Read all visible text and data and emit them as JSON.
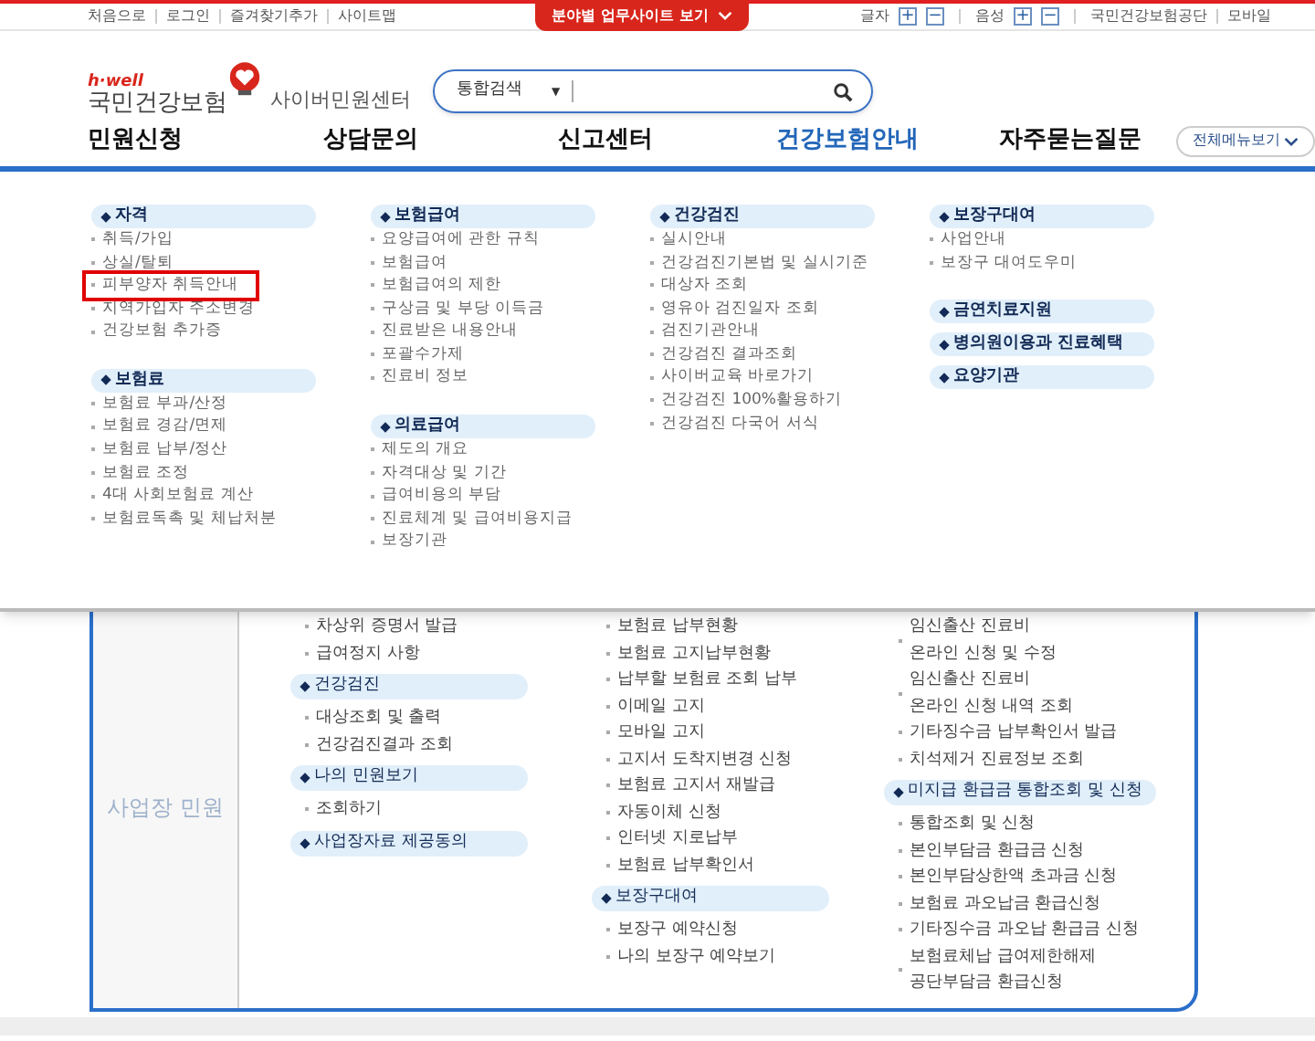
{
  "top_bar": {
    "links": [
      "처음으로",
      "로그인",
      "즐겨찾기추가",
      "사이트맵"
    ],
    "center_tab": "분야별 업무사이트 보기",
    "controls": [
      {
        "label": "글자",
        "plus": "+",
        "minus": "−"
      },
      {
        "label": "음성",
        "plus": "+",
        "minus": "−"
      }
    ],
    "right_links": [
      "국민건강보험공단",
      "모바일"
    ]
  },
  "header": {
    "brand_small": "h·well",
    "brand": "국민건강보험",
    "subtitle": "사이버민원센터",
    "search": {
      "scope": "통합검색",
      "caret": "▼"
    }
  },
  "nav": {
    "items": [
      {
        "label": "민원신청",
        "selected": false
      },
      {
        "label": "상담문의",
        "selected": false
      },
      {
        "label": "신고센터",
        "selected": false
      },
      {
        "label": "건강보험안내",
        "selected": true
      },
      {
        "label": "자주묻는질문",
        "selected": false
      }
    ],
    "all_menu": "전체메뉴보기"
  },
  "mega_menu": {
    "columns": [
      [
        {
          "title": "자격",
          "items": [
            {
              "label": "취득/가입",
              "highlighted": false
            },
            {
              "label": "상실/탈퇴",
              "highlighted": false
            },
            {
              "label": "피부양자 취득안내",
              "highlighted": true
            },
            {
              "label": "지역가입자 주소변경",
              "highlighted": false
            },
            {
              "label": "건강보험 추가증",
              "highlighted": false
            }
          ]
        },
        {
          "title": "보험료",
          "items": [
            {
              "label": "보험료 부과/산정",
              "highlighted": false
            },
            {
              "label": "보험료 경감/면제",
              "highlighted": false
            },
            {
              "label": "보험료 납부/정산",
              "highlighted": false
            },
            {
              "label": "보험료 조정",
              "highlighted": false
            },
            {
              "label": "4대 사회보험료 계산",
              "highlighted": false
            },
            {
              "label": "보험료독촉 및 체납처분",
              "highlighted": false
            }
          ]
        }
      ],
      [
        {
          "title": "보험급여",
          "items": [
            {
              "label": "요양급여에 관한 규칙",
              "highlighted": false
            },
            {
              "label": "보험급여",
              "highlighted": false
            },
            {
              "label": "보험급여의 제한",
              "highlighted": false
            },
            {
              "label": "구상금 및 부당 이득금",
              "highlighted": false
            },
            {
              "label": "진료받은 내용안내",
              "highlighted": false
            },
            {
              "label": "포괄수가제",
              "highlighted": false
            },
            {
              "label": "진료비 정보",
              "highlighted": false
            }
          ]
        },
        {
          "title": "의료급여",
          "items": [
            {
              "label": "제도의 개요",
              "highlighted": false
            },
            {
              "label": "자격대상 및 기간",
              "highlighted": false
            },
            {
              "label": "급여비용의 부담",
              "highlighted": false
            },
            {
              "label": "진료체계 및 급여비용지급",
              "highlighted": false
            },
            {
              "label": "보장기관",
              "highlighted": false
            }
          ]
        }
      ],
      [
        {
          "title": "건강검진",
          "items": [
            {
              "label": "실시안내",
              "highlighted": false
            },
            {
              "label": "건강검진기본법 및 실시기준",
              "highlighted": false
            },
            {
              "label": "대상자 조회",
              "highlighted": false
            },
            {
              "label": "영유아 검진일자 조회",
              "highlighted": false
            },
            {
              "label": "검진기관안내",
              "highlighted": false
            },
            {
              "label": "건강검진 결과조회",
              "highlighted": false
            },
            {
              "label": "사이버교육 바로가기",
              "highlighted": false
            },
            {
              "label": "건강검진 100%활용하기",
              "highlighted": false
            },
            {
              "label": "건강검진 다국어 서식",
              "highlighted": false
            }
          ]
        }
      ],
      [
        {
          "title": "보장구대여",
          "items": [
            {
              "label": "사업안내",
              "highlighted": false
            },
            {
              "label": "보장구 대여도우미",
              "highlighted": false
            }
          ]
        },
        {
          "title": "금연치료지원"
        },
        {
          "title": "병의원이용과 진료혜택"
        },
        {
          "title": "요양기관"
        }
      ]
    ]
  },
  "workplace": {
    "side_label": "사업장 민원",
    "columns": [
      [
        {
          "items": [
            "차상위 증명서 발급",
            "급여정지 사항"
          ]
        },
        {
          "title": "건강검진",
          "items": [
            "대상조회 및 출력",
            "건강검진결과 조회"
          ]
        },
        {
          "title": "나의 민원보기",
          "items": [
            "조회하기"
          ]
        },
        {
          "title": "사업장자료 제공동의"
        }
      ],
      [
        {
          "items": [
            "보험료 납부현황",
            "보험료 고지납부현황",
            "납부할 보험료 조회 납부",
            "이메일 고지",
            "모바일 고지",
            "고지서 도착지변경 신청",
            "보험료 고지서 재발급",
            "자동이체 신청",
            "인터넷 지로납부",
            "보험료 납부확인서"
          ]
        },
        {
          "title": "보장구대여",
          "items": [
            "보장구 예약신청",
            "나의 보장구 예약보기"
          ]
        }
      ],
      [
        {
          "items": [
            "임신출산 진료비\n온라인 신청 및 수정",
            "임신출산 진료비\n온라인 신청 내역 조회",
            "기타징수금 납부확인서 발급",
            "치석제거 진료정보 조회"
          ]
        },
        {
          "title": "미지급 환급금 통합조회 및 신청",
          "items": [
            "통합조회 및 신청",
            "본인부담금 환급금 신청",
            "본인부담상한액 초과금 신청",
            "보험료 과오납금 환급신청",
            "기타징수금 과오납 환급금 신청",
            "보험료체납 급여제한해제\n공단부담금 환급신청"
          ]
        }
      ]
    ]
  }
}
